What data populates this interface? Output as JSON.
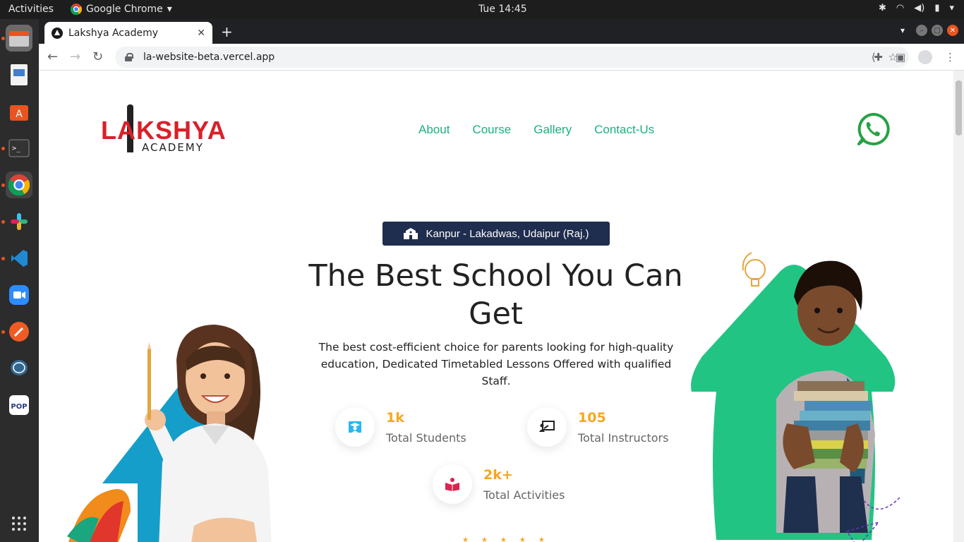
{
  "system": {
    "activities": "Activities",
    "app_name": "Google Chrome",
    "clock": "Tue 14:45"
  },
  "browser": {
    "tab_title": "Lakshya Academy",
    "url": "la-website-beta.vercel.app"
  },
  "site": {
    "logo_text": "LAKSHYA",
    "logo_sub": "ACADEMY",
    "nav": [
      "About",
      "Course",
      "Gallery",
      "Contact-Us"
    ],
    "badge": "Kanpur - Lakadwas, Udaipur (Raj.)",
    "headline": "The Best School You Can Get",
    "subtext": "The best cost-efficient choice for parents looking for high-quality education, Dedicated Timetabled Lessons Offered with qualified Staff.",
    "stats": [
      {
        "value": "1k",
        "label": "Total Students",
        "icon": "graduate-icon"
      },
      {
        "value": "105",
        "label": "Total Instructors",
        "icon": "instructor-icon"
      },
      {
        "value": "2k+",
        "label": "Total Activities",
        "icon": "book-icon"
      }
    ]
  },
  "colors": {
    "accent_green": "#19b37d",
    "stat_gold": "#f5a623",
    "badge_navy": "#1f2d4e",
    "logo_red": "#d9202a",
    "whatsapp_green": "#25a244"
  }
}
